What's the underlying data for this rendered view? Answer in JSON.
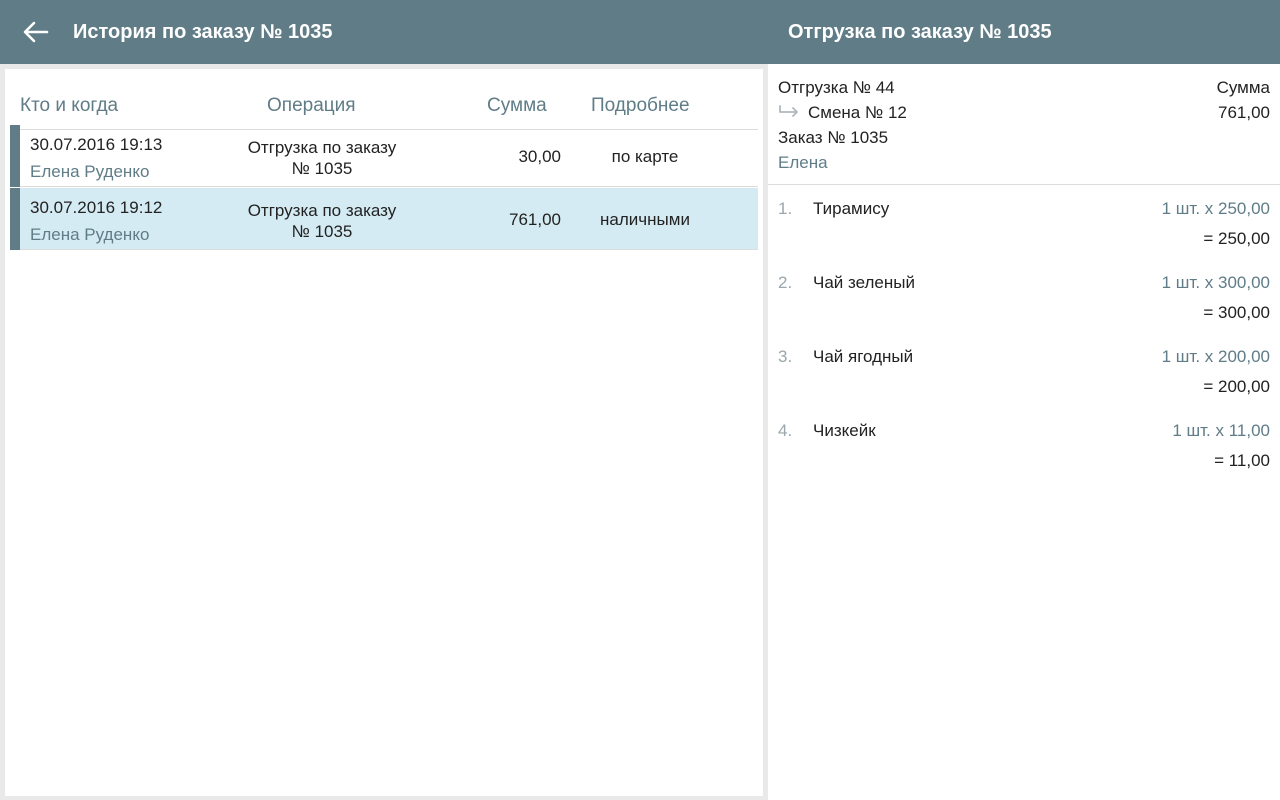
{
  "colors": {
    "topbar": "#5f7c87",
    "accent": "#5f7c87",
    "selected_row": "#d5ebf4",
    "pane_bg": "#e9e9e9"
  },
  "header": {
    "back_icon": "arrow-left-icon",
    "left_title": "История по заказу № 1035",
    "right_title": "Отгрузка по заказу № 1035"
  },
  "history": {
    "columns": {
      "who_when": "Кто и когда",
      "operation": "Операция",
      "sum": "Сумма",
      "details": "Подробнее"
    },
    "rows": [
      {
        "date": "30.07.2016 19:13",
        "user": "Елена Руденко",
        "operation_line1": "Отгрузка по заказу",
        "operation_line2": "№ 1035",
        "sum": "30,00",
        "details": "по карте",
        "selected": false
      },
      {
        "date": "30.07.2016 19:12",
        "user": "Елена Руденко",
        "operation_line1": "Отгрузка по заказу",
        "operation_line2": "№ 1035",
        "sum": "761,00",
        "details": "наличными",
        "selected": true
      }
    ]
  },
  "shipment": {
    "title": "Отгрузка № 44",
    "shift": "Смена № 12",
    "order": "Заказ № 1035",
    "user": "Елена",
    "sum_label": "Сумма",
    "sum_value": "761,00",
    "items": [
      {
        "num": "1.",
        "name": "Тирамису",
        "qty": "1 шт. х 250,00",
        "total": "= 250,00"
      },
      {
        "num": "2.",
        "name": "Чай зеленый",
        "qty": "1 шт. х 300,00",
        "total": "= 300,00"
      },
      {
        "num": "3.",
        "name": "Чай ягодный",
        "qty": "1 шт. х 200,00",
        "total": "= 200,00"
      },
      {
        "num": "4.",
        "name": "Чизкейк",
        "qty": "1 шт. х 11,00",
        "total": "= 11,00"
      }
    ]
  }
}
